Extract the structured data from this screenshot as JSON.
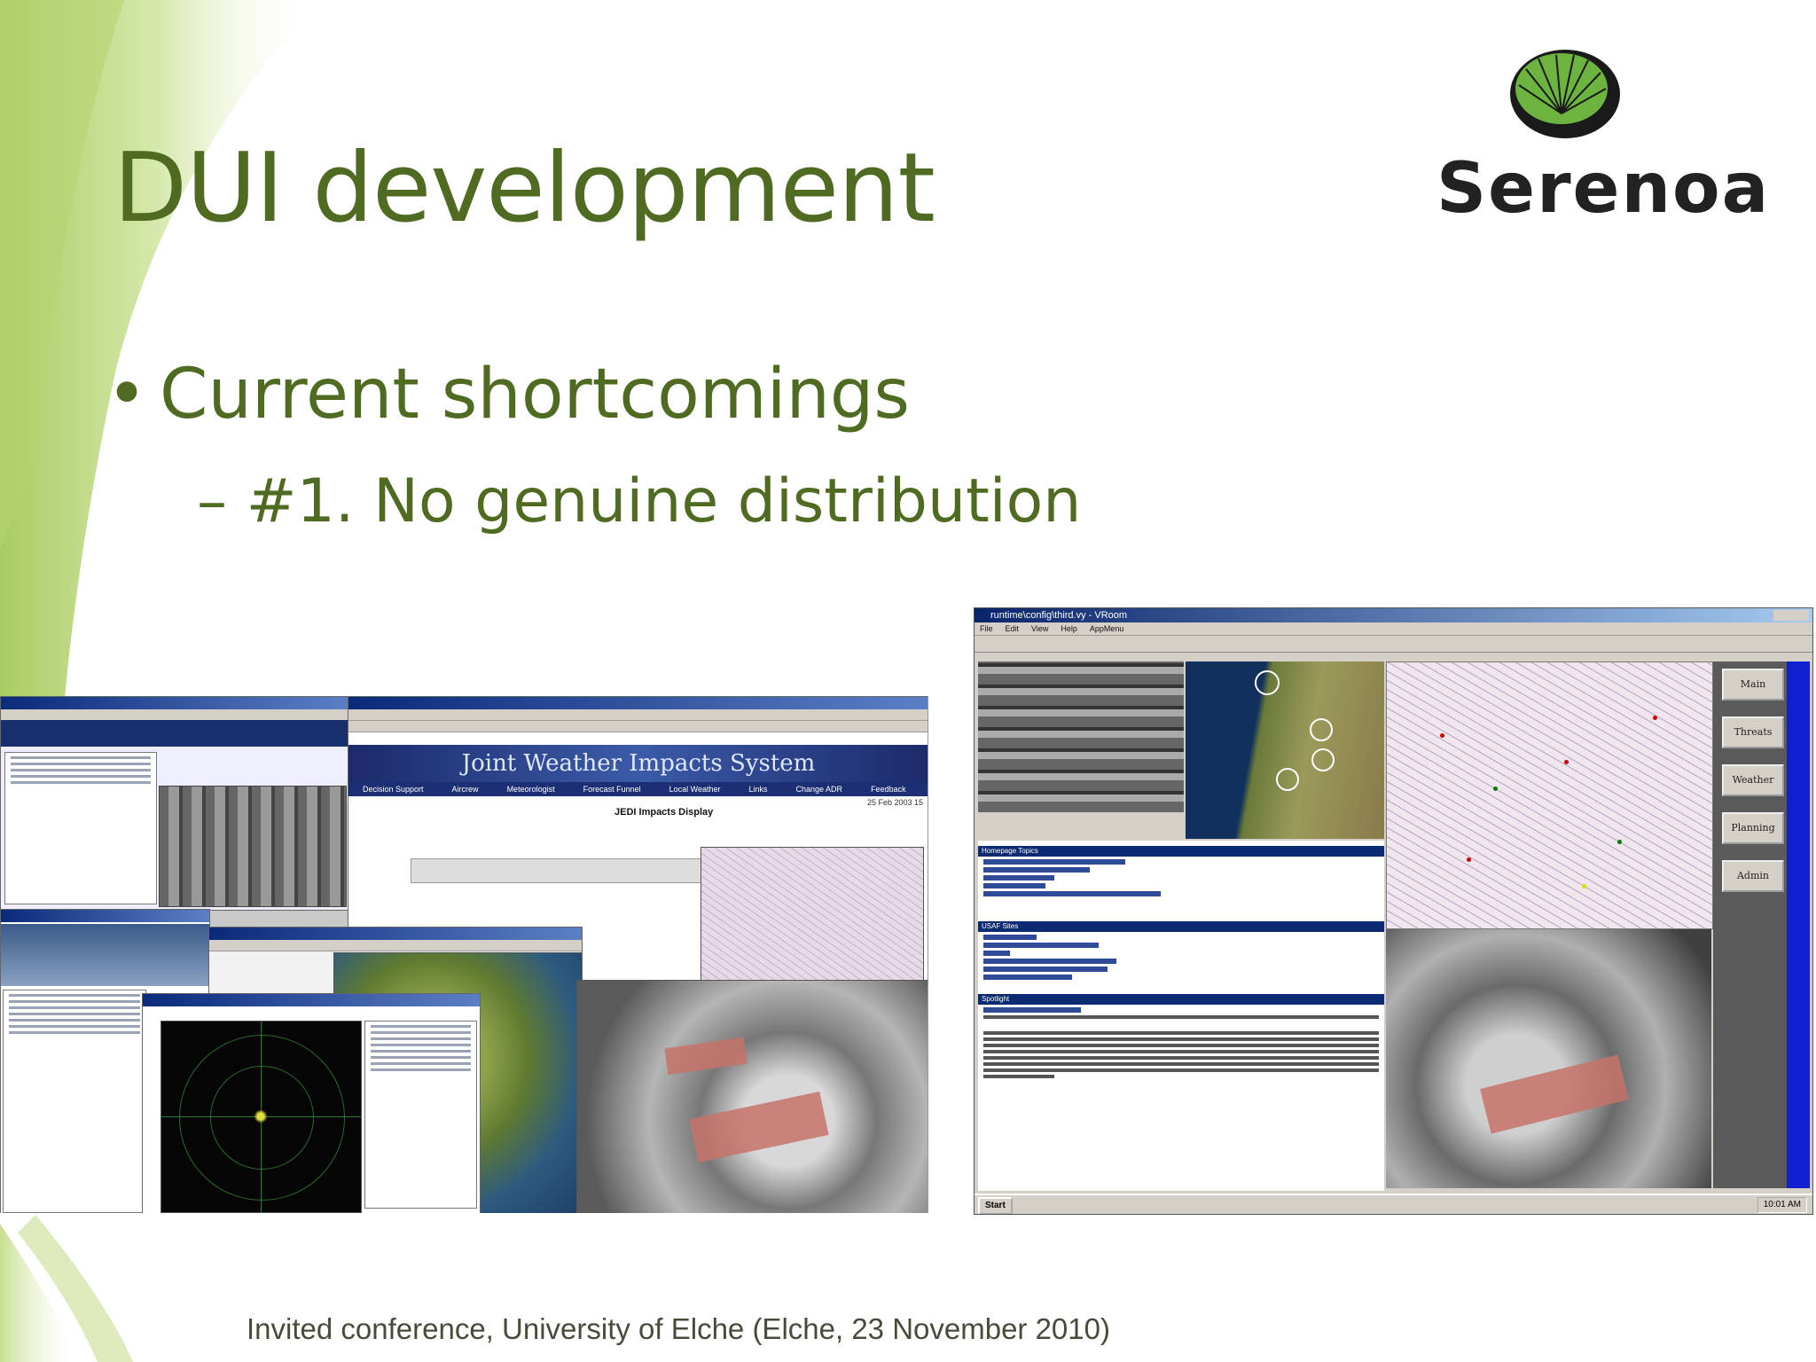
{
  "slide": {
    "title": "DUI development",
    "bullet": "Current shortcomings",
    "bullet_marker": "•",
    "sub_bullet": "– #1. No genuine distribution",
    "footer": "Invited conference, University of Elche (Elche, 23 November 2010)"
  },
  "logo": {
    "text": "Serenoa",
    "colors": {
      "leaf": "#6db33f",
      "ring": "#1a1a1a",
      "text": "#222222"
    }
  },
  "collage": {
    "banner": "Joint Weather Impacts System",
    "nav_items": [
      "Decision Support",
      "Aircrew",
      "Meteorologist",
      "Forecast Funnel",
      "Local Weather",
      "Links",
      "Change ADR",
      "Feedback"
    ],
    "display_title": "JEDI Impacts Display",
    "date_text": "25 Feb 2003 15"
  },
  "vroom": {
    "window_title": "runtime\\config\\third.vy - VRoom",
    "menu": [
      "File",
      "Edit",
      "View",
      "Help",
      "AppMenu"
    ],
    "side_buttons": [
      "Main",
      "Threats",
      "Weather",
      "Planning",
      "Admin"
    ],
    "sections": [
      "Homepage Topics",
      "USAF Sites",
      "Spotlight"
    ],
    "start_label": "Start",
    "clock": "10:01 AM"
  },
  "colors": {
    "title_green": "#4f6b22",
    "swoosh_light": "#e6f1c9",
    "swoosh_mid": "#b7d47a"
  }
}
